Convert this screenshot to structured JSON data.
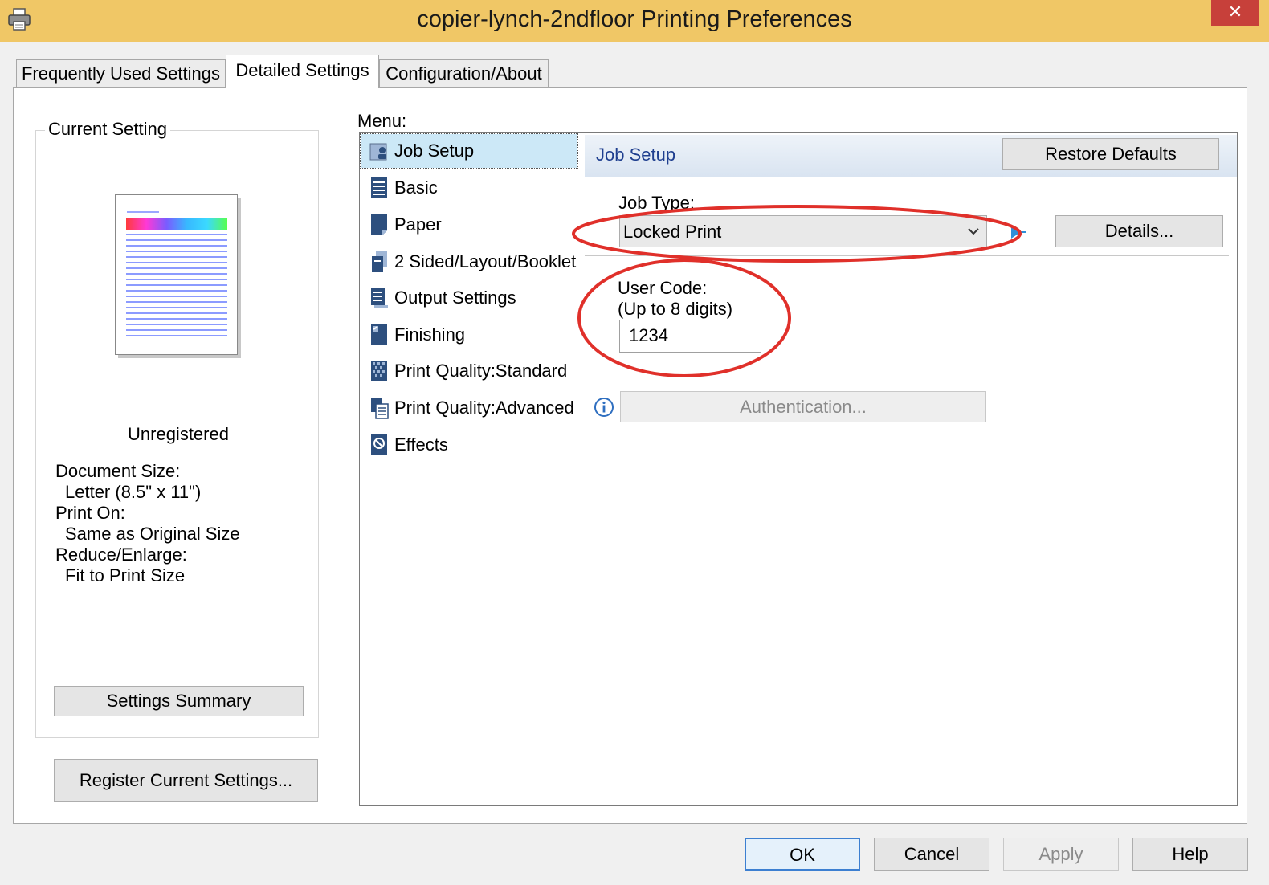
{
  "window": {
    "title": "copier-lynch-2ndfloor Printing Preferences",
    "close_label": "✕"
  },
  "tabs": [
    {
      "label": "Frequently Used Settings",
      "active": false
    },
    {
      "label": "Detailed Settings",
      "active": true
    },
    {
      "label": "Configuration/About",
      "active": false
    }
  ],
  "current_setting": {
    "group_title": "Current Setting",
    "status": "Unregistered",
    "document_size_label": "Document Size:",
    "document_size_value": "Letter (8.5\" x 11\")",
    "print_on_label": "Print On:",
    "print_on_value": "Same as Original Size",
    "reduce_enlarge_label": "Reduce/Enlarge:",
    "reduce_enlarge_value": "Fit to Print Size",
    "summary_button": "Settings Summary"
  },
  "register_button": "Register Current Settings...",
  "menu": {
    "label": "Menu:",
    "items": [
      {
        "label": "Job Setup",
        "icon": "job-setup-icon",
        "selected": true
      },
      {
        "label": "Basic",
        "icon": "basic-icon"
      },
      {
        "label": "Paper",
        "icon": "paper-icon"
      },
      {
        "label": "2 Sided/Layout/Booklet",
        "icon": "layout-icon"
      },
      {
        "label": "Output Settings",
        "icon": "output-icon"
      },
      {
        "label": "Finishing",
        "icon": "finishing-icon"
      },
      {
        "label": "Print Quality:Standard",
        "icon": "quality-standard-icon"
      },
      {
        "label": "Print Quality:Advanced",
        "icon": "quality-advanced-icon"
      },
      {
        "label": "Effects",
        "icon": "effects-icon"
      }
    ]
  },
  "job_setup": {
    "header": "Job Setup",
    "restore_defaults": "Restore Defaults",
    "job_type_label": "Job Type:",
    "job_type_value": "Locked Print",
    "details_button": "Details...",
    "user_code_label": "User Code:",
    "user_code_hint": "(Up to 8 digits)",
    "user_code_value": "1234",
    "authentication_button": "Authentication...",
    "info_icon": "info-icon"
  },
  "footer": {
    "ok": "OK",
    "cancel": "Cancel",
    "apply": "Apply",
    "help": "Help"
  },
  "colors": {
    "titlebar": "#f0c766",
    "close": "#c7403a",
    "annotation": "#e0302a",
    "selected_menu": "#cce8f7",
    "header_text": "#1f3f8f"
  }
}
